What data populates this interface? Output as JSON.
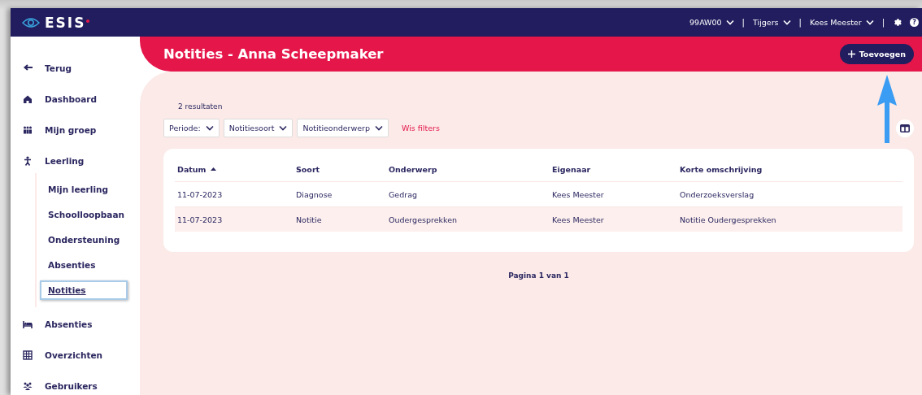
{
  "topbar": {
    "logo": "ESIS",
    "menus": [
      {
        "label": "99AW00"
      },
      {
        "label": "Tijgers"
      },
      {
        "label": "Kees Meester"
      }
    ],
    "separator": "|",
    "help": "?"
  },
  "sidebar": {
    "items": [
      {
        "label": "Terug",
        "selected": false
      },
      {
        "label": "Dashboard",
        "selected": false
      },
      {
        "label": "Mijn groep",
        "selected": false
      },
      {
        "label": "Leerling",
        "selected": false,
        "expanded": true,
        "children": [
          {
            "label": "Mijn leerling",
            "selected": false
          },
          {
            "label": "Schoolloopbaan",
            "selected": false
          },
          {
            "label": "Ondersteuning",
            "selected": false
          },
          {
            "label": "Absenties",
            "selected": false
          },
          {
            "label": "Notities",
            "selected": true
          }
        ]
      },
      {
        "label": "Absenties",
        "selected": false
      },
      {
        "label": "Overzichten",
        "selected": false
      },
      {
        "label": "Gebruikers",
        "selected": false
      }
    ]
  },
  "header": {
    "title": "Notities - Anna Scheepmaker",
    "add_button": "Toevoegen"
  },
  "results": "2 resultaten",
  "filters": [
    {
      "label": "Periode:"
    },
    {
      "label": "Notitiesoort"
    },
    {
      "label": "Notitieonderwerp"
    }
  ],
  "clear_filters": "Wis filters",
  "table": {
    "columns": [
      {
        "label": "Datum",
        "sorted": true
      },
      {
        "label": "Soort",
        "sorted": false
      },
      {
        "label": "Onderwerp",
        "sorted": false
      },
      {
        "label": "Eigenaar",
        "sorted": false
      },
      {
        "label": "Korte omschrijving",
        "sorted": false
      }
    ],
    "rows": [
      {
        "cells": [
          "11-07-2023",
          "Diagnose",
          "Gedrag",
          "Kees Meester",
          "Onderzoeksverslag"
        ],
        "highlighted": false
      },
      {
        "cells": [
          "11-07-2023",
          "Notitie",
          "Oudergesprekken",
          "Kees Meester",
          "Notitie Oudergesprekken"
        ],
        "highlighted": true
      }
    ]
  },
  "pagination": "Pagina 1 van 1"
}
